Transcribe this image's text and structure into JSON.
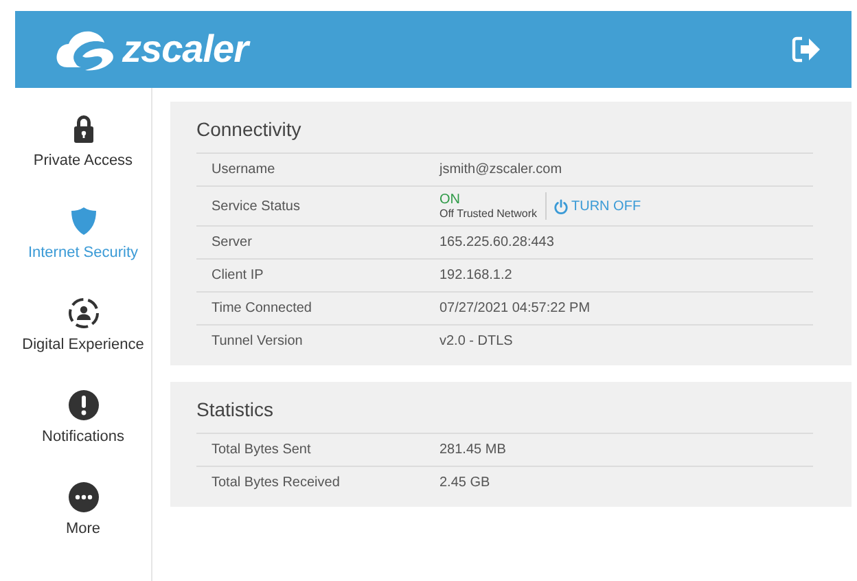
{
  "header": {
    "brand": "zscaler"
  },
  "sidebar": {
    "items": [
      {
        "label": "Private Access",
        "kind": "lock",
        "selected": false
      },
      {
        "label": "Internet Security",
        "kind": "shield",
        "selected": true
      },
      {
        "label": "Digital Experience",
        "kind": "person",
        "selected": false
      },
      {
        "label": "Notifications",
        "kind": "alert",
        "selected": false
      },
      {
        "label": "More",
        "kind": "more",
        "selected": false
      }
    ]
  },
  "sections": [
    {
      "title": "Connectivity",
      "rows": [
        {
          "kind": "text",
          "label": "Username",
          "value": "jsmith@zscaler.com"
        },
        {
          "kind": "status",
          "label": "Service Status",
          "value": "ON",
          "on": true,
          "note": "Off Trusted Network",
          "action": "TURN OFF"
        },
        {
          "kind": "text",
          "label": "Server",
          "value": "165.225.60.28:443"
        },
        {
          "kind": "text",
          "label": "Client IP",
          "value": "192.168.1.2"
        },
        {
          "kind": "text",
          "label": "Time Connected",
          "value": "07/27/2021 04:57:22 PM"
        },
        {
          "kind": "text",
          "label": "Tunnel Version",
          "value": "v2.0 - DTLS"
        }
      ]
    },
    {
      "title": "Statistics",
      "rows": [
        {
          "kind": "text",
          "label": "Total Bytes Sent",
          "value": "281.45 MB"
        },
        {
          "kind": "text",
          "label": "Total Bytes Received",
          "value": "2.45 GB"
        }
      ]
    }
  ]
}
